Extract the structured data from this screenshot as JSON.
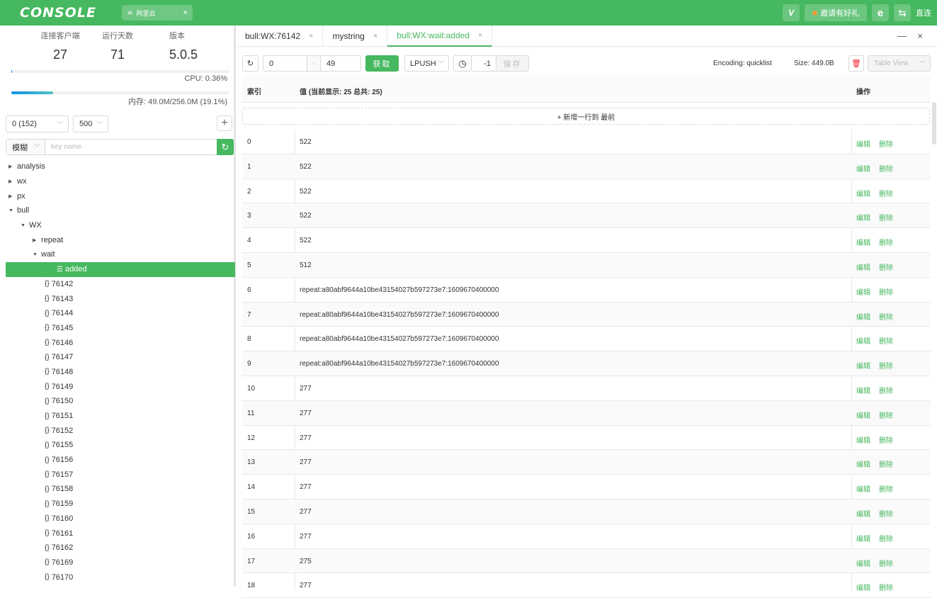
{
  "app": {
    "logo": "CONSOLE",
    "connection": "阿里云",
    "vip": "V",
    "invite": "邀请有好礼",
    "ie": "e",
    "switch": "⇆",
    "direct": "直连"
  },
  "stats": {
    "clients_label": "连接客户端",
    "clients": "27",
    "uptime_label": "运行天数",
    "uptime": "71",
    "version_label": "版本",
    "version": "5.0.5",
    "cpu": "CPU: 0.36%",
    "cpu_level": 0.0036,
    "mem": "内存: 49.0M/256.0M (19.1%)",
    "mem_level": 0.191
  },
  "sidebar": {
    "db_select": "0 (152)",
    "count_select": "500",
    "add": "+",
    "mode": "模糊",
    "search_placeholder": "key name",
    "tree": [
      {
        "label": "analysis",
        "depth": 0,
        "type": "folder",
        "open": false
      },
      {
        "label": "wx",
        "depth": 0,
        "type": "folder",
        "open": false
      },
      {
        "label": "px",
        "depth": 0,
        "type": "folder",
        "open": false
      },
      {
        "label": "bull",
        "depth": 0,
        "type": "folder",
        "open": true
      },
      {
        "label": "WX",
        "depth": 1,
        "type": "folder",
        "open": true
      },
      {
        "label": "repeat",
        "depth": 2,
        "type": "folder",
        "open": false
      },
      {
        "label": "wait",
        "depth": 2,
        "type": "folder",
        "open": true
      },
      {
        "label": "added",
        "depth": 4,
        "type": "list",
        "selected": true
      },
      {
        "label": "76142",
        "depth": 3,
        "type": "hash"
      },
      {
        "label": "76143",
        "depth": 3,
        "type": "hash"
      },
      {
        "label": "76144",
        "depth": 3,
        "type": "hash"
      },
      {
        "label": "76145",
        "depth": 3,
        "type": "hash"
      },
      {
        "label": "76146",
        "depth": 3,
        "type": "hash"
      },
      {
        "label": "76147",
        "depth": 3,
        "type": "hash"
      },
      {
        "label": "76148",
        "depth": 3,
        "type": "hash"
      },
      {
        "label": "76149",
        "depth": 3,
        "type": "hash"
      },
      {
        "label": "76150",
        "depth": 3,
        "type": "hash"
      },
      {
        "label": "76151",
        "depth": 3,
        "type": "hash"
      },
      {
        "label": "76152",
        "depth": 3,
        "type": "hash"
      },
      {
        "label": "76155",
        "depth": 3,
        "type": "hash"
      },
      {
        "label": "76156",
        "depth": 3,
        "type": "hash"
      },
      {
        "label": "76157",
        "depth": 3,
        "type": "hash"
      },
      {
        "label": "76158",
        "depth": 3,
        "type": "hash"
      },
      {
        "label": "76159",
        "depth": 3,
        "type": "hash"
      },
      {
        "label": "76160",
        "depth": 3,
        "type": "hash"
      },
      {
        "label": "76161",
        "depth": 3,
        "type": "hash"
      },
      {
        "label": "76162",
        "depth": 3,
        "type": "hash"
      },
      {
        "label": "76169",
        "depth": 3,
        "type": "hash"
      },
      {
        "label": "76170",
        "depth": 3,
        "type": "hash"
      }
    ]
  },
  "tabs": [
    {
      "label": "bull:WX:76142",
      "active": false
    },
    {
      "label": "mystring",
      "active": false
    },
    {
      "label": "bull:WX:wait:added",
      "active": true
    }
  ],
  "window_controls": "— ×",
  "toolbar": {
    "start": "0",
    "dash": "-",
    "end": "49",
    "fetch": "获取",
    "push": "LPUSH",
    "ttl": "-1",
    "save": "保存",
    "encoding": "Encoding: quicklist",
    "size": "Size: 449.0B",
    "view": "Table View"
  },
  "table": {
    "col_index": "索引",
    "col_value": "值 (当前显示: 25 总共: 25)",
    "col_ops": "操作",
    "add_row": "+ 新增一行到 最前",
    "edit": "编辑",
    "delete": "删除",
    "rows": [
      {
        "i": "0",
        "v": "522"
      },
      {
        "i": "1",
        "v": "522"
      },
      {
        "i": "2",
        "v": "522"
      },
      {
        "i": "3",
        "v": "522"
      },
      {
        "i": "4",
        "v": "522"
      },
      {
        "i": "5",
        "v": "512"
      },
      {
        "i": "6",
        "v": "repeat:a80abf9644a10be43154027b597273e7:1609670400000"
      },
      {
        "i": "7",
        "v": "repeat:a80abf9644a10be43154027b597273e7:1609670400000"
      },
      {
        "i": "8",
        "v": "repeat:a80abf9644a10be43154027b597273e7:1609670400000"
      },
      {
        "i": "9",
        "v": "repeat:a80abf9644a10be43154027b597273e7:1609670400000"
      },
      {
        "i": "10",
        "v": "277"
      },
      {
        "i": "11",
        "v": "277"
      },
      {
        "i": "12",
        "v": "277"
      },
      {
        "i": "13",
        "v": "277"
      },
      {
        "i": "14",
        "v": "277"
      },
      {
        "i": "15",
        "v": "277"
      },
      {
        "i": "16",
        "v": "277"
      },
      {
        "i": "17",
        "v": "275"
      },
      {
        "i": "18",
        "v": "277"
      }
    ]
  },
  "colors": {
    "accent": "#46b85f",
    "progress": "#1890ff",
    "danger": "#f5222d"
  }
}
